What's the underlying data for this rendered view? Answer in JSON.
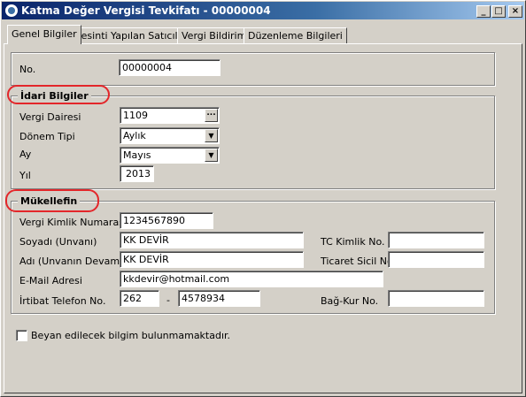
{
  "window": {
    "title": "Katma Değer Vergisi Tevkifatı - 00000004",
    "minimize": "_",
    "maximize": "□",
    "close": "×"
  },
  "tabs": [
    "Genel Bilgiler",
    "Kesinti Yapılan Satıcılar",
    "Vergi Bildirimi",
    "Düzenleme Bilgileri"
  ],
  "top": {
    "no_label": "No.",
    "no_value": "00000004"
  },
  "idari": {
    "title": "İdari Bilgiler",
    "vergi_dairesi_label": "Vergi Dairesi",
    "vergi_dairesi_value": "1109",
    "browse": "...",
    "donem_tipi_label": "Dönem Tipi",
    "donem_tipi_value": "Aylık",
    "ay_label": "Ay",
    "ay_value": "Mayıs",
    "yil_label": "Yıl",
    "yil_value": "2013"
  },
  "mukellef": {
    "title": "Mükellefin",
    "vkn_label": "Vergi Kimlik Numarası",
    "vkn_value": "1234567890",
    "soyadi_label": "Soyadı (Unvanı)",
    "soyadi_value": "KK DEVİR",
    "adi_label": "Adı (Unvanın Devamı)",
    "adi_value": "KK DEVİR",
    "email_label": "E-Mail Adresi",
    "email_value": "kkdevir@hotmail.com",
    "tel_label": "İrtibat Telefon No.",
    "tel_area": "262",
    "tel_dash": "-",
    "tel_number": "4578934",
    "tckn_label": "TC Kimlik No.",
    "tckn_value": "",
    "ticaret_label": "Ticaret Sicil No.",
    "ticaret_value": "",
    "bagkur_label": "Bağ-Kur No.",
    "bagkur_value": ""
  },
  "declaration": {
    "label": "Beyan edilecek bilgim bulunmamaktadır.",
    "checked": false
  },
  "colors": {
    "titlebar_start": "#0a246a",
    "titlebar_end": "#a6caf0",
    "highlight_circle": "#e3262a",
    "face": "#d4d0c8"
  }
}
